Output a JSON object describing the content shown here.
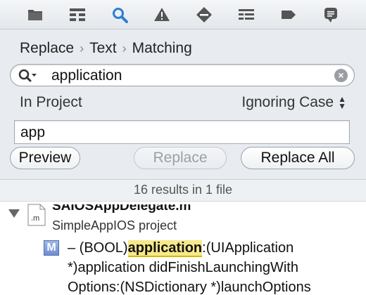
{
  "iconbar": {
    "icons": [
      "folder-icon",
      "hierarchy-icon",
      "search-icon",
      "warning-icon",
      "breakpoint-icon",
      "list-icon",
      "tag-icon",
      "message-icon"
    ],
    "active_color": "#2a7fd6"
  },
  "breadcrumb": {
    "mode": "Replace",
    "kind": "Text",
    "style": "Matching"
  },
  "search": {
    "value": "application"
  },
  "options": {
    "scope": "In Project",
    "case": "Ignoring Case"
  },
  "replace": {
    "value": "app"
  },
  "buttons": {
    "preview": "Preview",
    "replace": "Replace",
    "replace_all": "Replace All"
  },
  "results": {
    "summary": "16 results in 1 file",
    "file_name": "SAIOSAppDelegate.m",
    "file_ext_icon": ".m",
    "project": "SimpleAppIOS project",
    "badge": "M",
    "match_lines": {
      "prefix": "– (BOOL)",
      "highlight": "application",
      "suffix": ":(UIApplication",
      "line2": "*)application didFinishLaunchingWith",
      "line3": "Options:(NSDictionary *)launchOptions"
    }
  }
}
